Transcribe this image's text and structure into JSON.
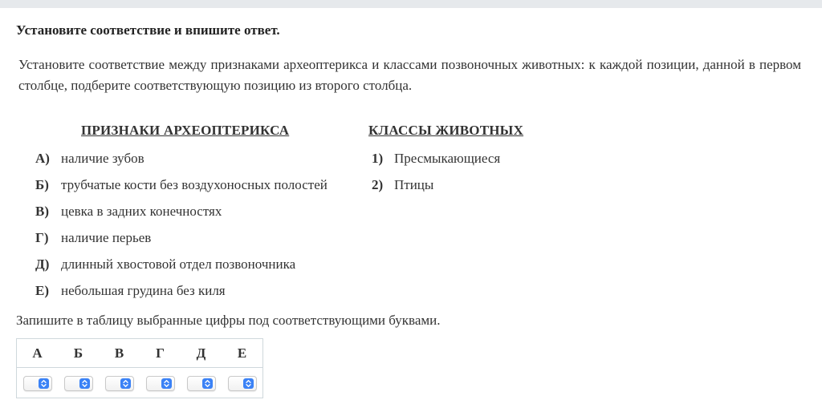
{
  "instruction": "Установите соответствие и впишите ответ.",
  "question": "Установите соответствие между признаками археоптерикса и классами позвоночных животных: к каждой позиции, данной в первом столбце, подберите соответствующую позицию из второго столбца.",
  "left_column": {
    "header": "ПРИЗНАКИ АРХЕОПТЕРИКСА",
    "items": [
      {
        "letter": "А)",
        "text": "наличие зубов"
      },
      {
        "letter": "Б)",
        "text": "трубчатые кости без воздухоносных полостей"
      },
      {
        "letter": "В)",
        "text": "цевка в задних конечностях"
      },
      {
        "letter": "Г)",
        "text": "наличие перьев"
      },
      {
        "letter": "Д)",
        "text": "длинный хвостовой отдел позвоночника"
      },
      {
        "letter": "Е)",
        "text": "небольшая грудина без киля"
      }
    ]
  },
  "right_column": {
    "header": "КЛАССЫ ЖИВОТНЫХ",
    "items": [
      {
        "number": "1)",
        "text": "Пресмыкающиеся"
      },
      {
        "number": "2)",
        "text": "Птицы"
      }
    ]
  },
  "write_hint": "Запишите в таблицу выбранные цифры под соответствующими буквами.",
  "answer_table": {
    "headers": [
      "А",
      "Б",
      "В",
      "Г",
      "Д",
      "Е"
    ],
    "selects": [
      {
        "value": "",
        "icon": "select-arrows-icon"
      },
      {
        "value": "",
        "icon": "select-arrows-icon"
      },
      {
        "value": "",
        "icon": "select-arrows-icon"
      },
      {
        "value": "",
        "icon": "select-arrows-icon"
      },
      {
        "value": "",
        "icon": "select-arrows-icon"
      },
      {
        "value": "",
        "icon": "select-arrows-icon"
      }
    ]
  },
  "colors": {
    "accent": "#3b82f6",
    "border": "#cfd8dc",
    "top_bar": "#e6e9ec"
  }
}
